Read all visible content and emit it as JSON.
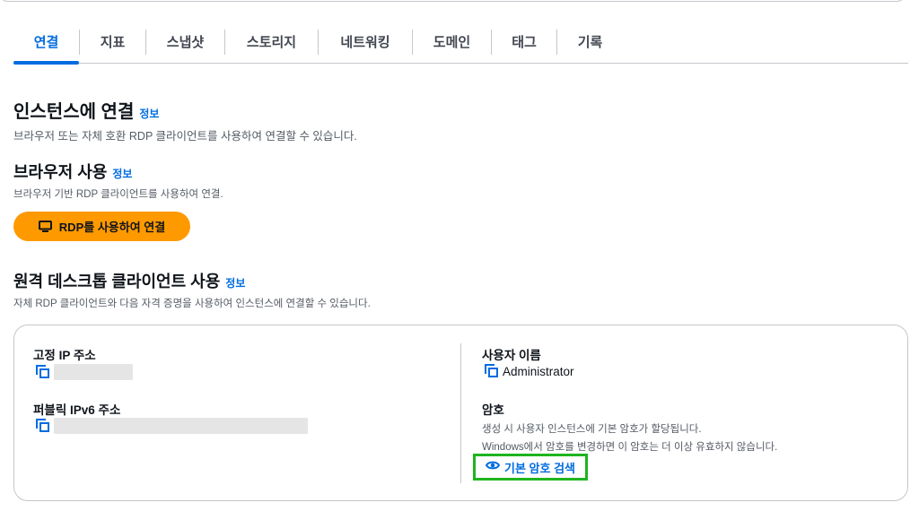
{
  "tabs": [
    {
      "label": "연결",
      "active": true
    },
    {
      "label": "지표"
    },
    {
      "label": "스냅샷"
    },
    {
      "label": "스토리지"
    },
    {
      "label": "네트워킹"
    },
    {
      "label": "도메인"
    },
    {
      "label": "태그"
    },
    {
      "label": "기록"
    }
  ],
  "connect": {
    "title": "인스턴스에 연결",
    "info": "정보",
    "description": "브라우저 또는 자체 호환 RDP 클라이언트를 사용하여 연결할 수 있습니다."
  },
  "browser": {
    "title": "브라우저 사용",
    "info": "정보",
    "description": "브라우저 기반 RDP 클라이언트를 사용하여 연결.",
    "button_label": "RDP를 사용하여 연결"
  },
  "remote": {
    "title": "원격 데스크톱 클라이언트 사용",
    "info": "정보",
    "description": "자체 RDP 클라이언트와 다음 자격 증명을 사용하여 인스턴스에 연결할 수 있습니다."
  },
  "details": {
    "static_ip_label": "고정 IP 주소",
    "ipv6_label": "퍼블릭 IPv6 주소",
    "username_label": "사용자 이름",
    "username_value": "Administrator",
    "password_label": "암호",
    "password_help_1": "생성 시 사용자 인스턴스에 기본 암호가 할당됩니다.",
    "password_help_2": "Windows에서 암호를 변경하면 이 암호는 더 이상 유효하지 않습니다.",
    "retrieve_label": "기본 암호 검색"
  },
  "icons": {
    "monitor": "monitor-icon",
    "copy": "copy-icon",
    "eye": "eye-icon"
  },
  "colors": {
    "accent": "#006ce0",
    "primary_button": "#ff9900",
    "highlight": "#1fb41f"
  }
}
